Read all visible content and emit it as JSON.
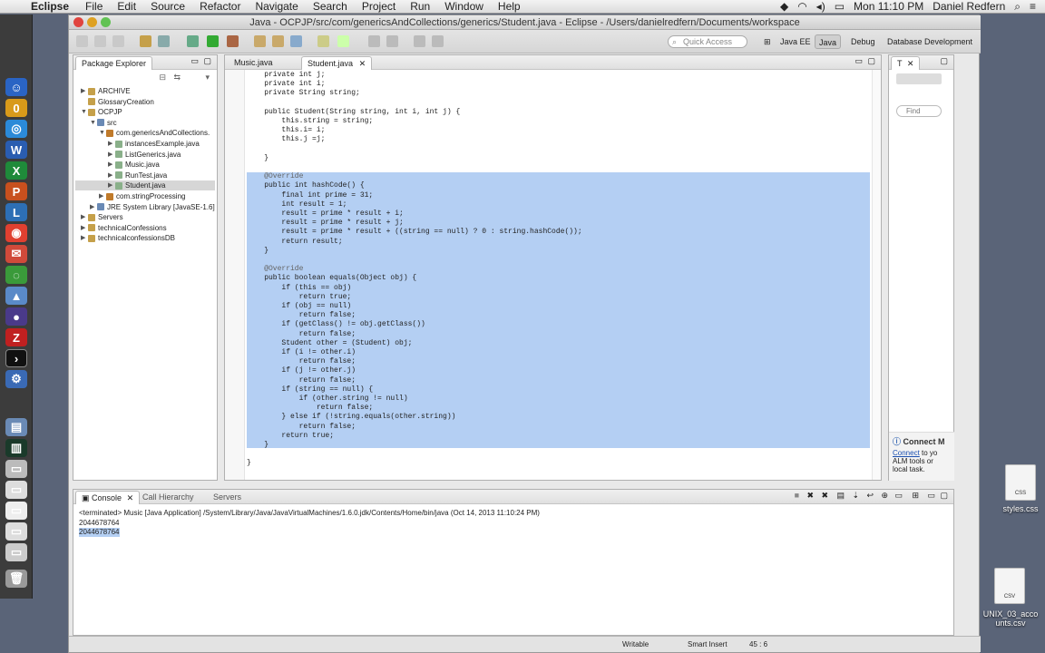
{
  "menubar": {
    "app_name": "Eclipse",
    "items": [
      "File",
      "Edit",
      "Source",
      "Refactor",
      "Navigate",
      "Search",
      "Project",
      "Run",
      "Window",
      "Help"
    ],
    "clock": "Mon 11:10 PM",
    "user": "Daniel Redfern"
  },
  "window": {
    "title": "Java - OCPJP/src/com/genericsAndCollections/generics/Student.java - Eclipse - /Users/danielredfern/Documents/workspace",
    "quick_access_placeholder": "Quick Access",
    "perspectives": [
      "Java EE",
      "Java",
      "Debug",
      "Database Development"
    ]
  },
  "package_explorer": {
    "tab_label": "Package Explorer",
    "tree": [
      {
        "label": "ARCHIVE",
        "depth": 0,
        "twisty": "▶"
      },
      {
        "label": "GlossaryCreation",
        "depth": 0,
        "twisty": ""
      },
      {
        "label": "OCPJP",
        "depth": 0,
        "twisty": "▼"
      },
      {
        "label": "src",
        "depth": 1,
        "twisty": "▼"
      },
      {
        "label": "com.genericsAndCollections.",
        "depth": 2,
        "twisty": "▼"
      },
      {
        "label": "instancesExample.java",
        "depth": 3,
        "twisty": "▶"
      },
      {
        "label": "ListGenerics.java",
        "depth": 3,
        "twisty": "▶"
      },
      {
        "label": "Music.java",
        "depth": 3,
        "twisty": "▶"
      },
      {
        "label": "RunTest.java",
        "depth": 3,
        "twisty": "▶"
      },
      {
        "label": "Student.java",
        "depth": 3,
        "twisty": "▶",
        "selected": true
      },
      {
        "label": "com.stringProcessing",
        "depth": 2,
        "twisty": "▶"
      },
      {
        "label": "JRE System Library [JavaSE-1.6]",
        "depth": 1,
        "twisty": "▶"
      },
      {
        "label": "Servers",
        "depth": 0,
        "twisty": "▶"
      },
      {
        "label": "technicalConfessions",
        "depth": 0,
        "twisty": "▶"
      },
      {
        "label": "technicalconfessionsDB",
        "depth": 0,
        "twisty": "▶"
      }
    ]
  },
  "editor": {
    "tabs": [
      {
        "label": "Music.java",
        "active": false
      },
      {
        "label": "Student.java",
        "active": true
      }
    ],
    "lines": [
      "    private int j;",
      "    private int i;",
      "    private String string;",
      "",
      "    public Student(String string, int i, int j) {",
      "        this.string = string;",
      "        this.i= i;",
      "        this.j =j;",
      "",
      "    }",
      "",
      "    @Override",
      "    public int hashCode() {",
      "        final int prime = 31;",
      "        int result = 1;",
      "        result = prime * result + i;",
      "        result = prime * result + j;",
      "        result = prime * result + ((string == null) ? 0 : string.hashCode());",
      "        return result;",
      "    }",
      "",
      "    @Override",
      "    public boolean equals(Object obj) {",
      "        if (this == obj)",
      "            return true;",
      "        if (obj == null)",
      "            return false;",
      "        if (getClass() != obj.getClass())",
      "            return false;",
      "        Student other = (Student) obj;",
      "        if (i != other.i)",
      "            return false;",
      "        if (j != other.j)",
      "            return false;",
      "        if (string == null) {",
      "            if (other.string != null)",
      "                return false;",
      "        } else if (!string.equals(other.string))",
      "            return false;",
      "        return true;",
      "    }",
      "",
      "}"
    ]
  },
  "right_panel": {
    "tab_label": "T",
    "find_placeholder": "Find",
    "connect_title": "Connect M",
    "connect_link": "Connect",
    "connect_text_1": "to yo",
    "connect_text_2": "ALM tools or",
    "connect_text_3": "local task."
  },
  "console": {
    "tabs": [
      "Console",
      "Call Hierarchy",
      "Servers"
    ],
    "header": "<terminated> Music [Java Application] /System/Library/Java/JavaVirtualMachines/1.6.0.jdk/Contents/Home/bin/java (Oct 14, 2013 11:10:24 PM)",
    "output": [
      "2044678764",
      "2044678764"
    ]
  },
  "statusbar": {
    "writable": "Writable",
    "insert_mode": "Smart Insert",
    "position": "45 : 6"
  },
  "desktop": {
    "file1": "styles.css",
    "file2_line1": "UNIX_03_acco",
    "file2_line2": "unts.csv",
    "file1_badge": "CSS",
    "file2_badge": "CSV"
  },
  "colors": {
    "selection": "#b4cff3",
    "keyword": "#7f0055",
    "field": "#0000c0",
    "annotation": "#646464"
  }
}
